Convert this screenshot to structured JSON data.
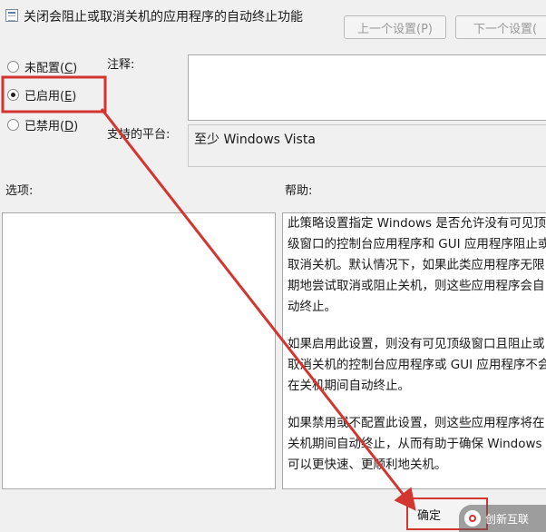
{
  "window": {
    "title": "关闭会阻止或取消关机的应用程序的自动终止功能"
  },
  "nav": {
    "prev_label": "上一个设置(P)",
    "next_label": "下一个设置("
  },
  "options": {
    "not_configured": {
      "label": "未配置(",
      "key": "C",
      "close": ")"
    },
    "enabled": {
      "label": "已启用(",
      "key": "E",
      "close": ")",
      "checked": true
    },
    "disabled": {
      "label": "已禁用(",
      "key": "D",
      "close": ")"
    }
  },
  "labels": {
    "comment": "注释:",
    "supported": "支持的平台:",
    "options": "选项:",
    "help": "帮助:"
  },
  "supported_value": "至少 Windows Vista",
  "help_text": {
    "p1": "此策略设置指定 Windows 是否允许没有可见顶级窗口的控制台应用程序和 GUI 应用程序阻止或取消关机。默认情况下，如果此类应用程序无限期地尝试取消或阻止关机，则这些应用程序会自动终止。",
    "p2": "如果启用此设置，则没有可见顶级窗口且阻止或取消关机的控制台应用程序或 GUI 应用程序不会在关机期间自动终止。",
    "p3": "如果禁用或不配置此设置，则这些应用程序将在关机期间自动终止，从而有助于确保 Windows 可以更快速、更顺利地关机。"
  },
  "buttons": {
    "ok_label": "确定"
  },
  "watermark": {
    "text": "创新互联"
  },
  "colors": {
    "annotation_red": "#d3352f"
  }
}
